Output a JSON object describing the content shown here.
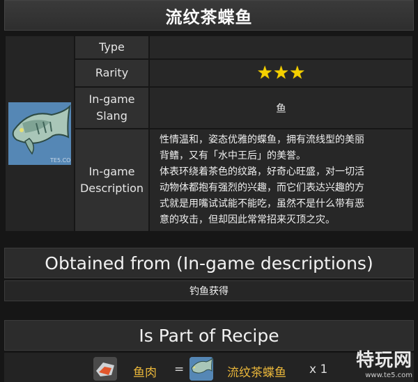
{
  "title": "流纹茶蝶鱼",
  "item_icon": "fish-icon",
  "rows": {
    "type_label": "Type",
    "type_value": "",
    "rarity_label": "Rarity",
    "rarity_stars": 3,
    "rarity_star_color": "#f4d000",
    "slang_label": "In-game Slang",
    "slang_value": "鱼",
    "desc_label": "In-game Description",
    "desc_line1": "性情温和，姿态优雅的蝶鱼，拥有流线型的美丽",
    "desc_line2": "背鳍，又有「水中王后」的美誉。",
    "desc_line3": "体表环绕着茶色的纹路，好奇心旺盛，对一切活",
    "desc_line4": "动物体都抱有强烈的兴趣，而它们表达兴趣的方",
    "desc_line5": "式就是用嘴试试能不能吃，虽然不是什么带有恶",
    "desc_line6": "意的攻击，但却因此常常招来灭顶之灾。"
  },
  "obtained": {
    "title": "Obtained from (In-game descriptions)",
    "value": "钓鱼获得"
  },
  "recipe": {
    "title": "Is Part of Recipe",
    "result_name": "鱼肉",
    "equals": "=",
    "ingredient_name": "流纹茶蝶鱼",
    "quantity": "x 1"
  },
  "watermark": {
    "text": "特玩网",
    "url": "www.te5.com"
  },
  "colors": {
    "accent_gold": "#e9b63a",
    "bg": "#161616"
  }
}
